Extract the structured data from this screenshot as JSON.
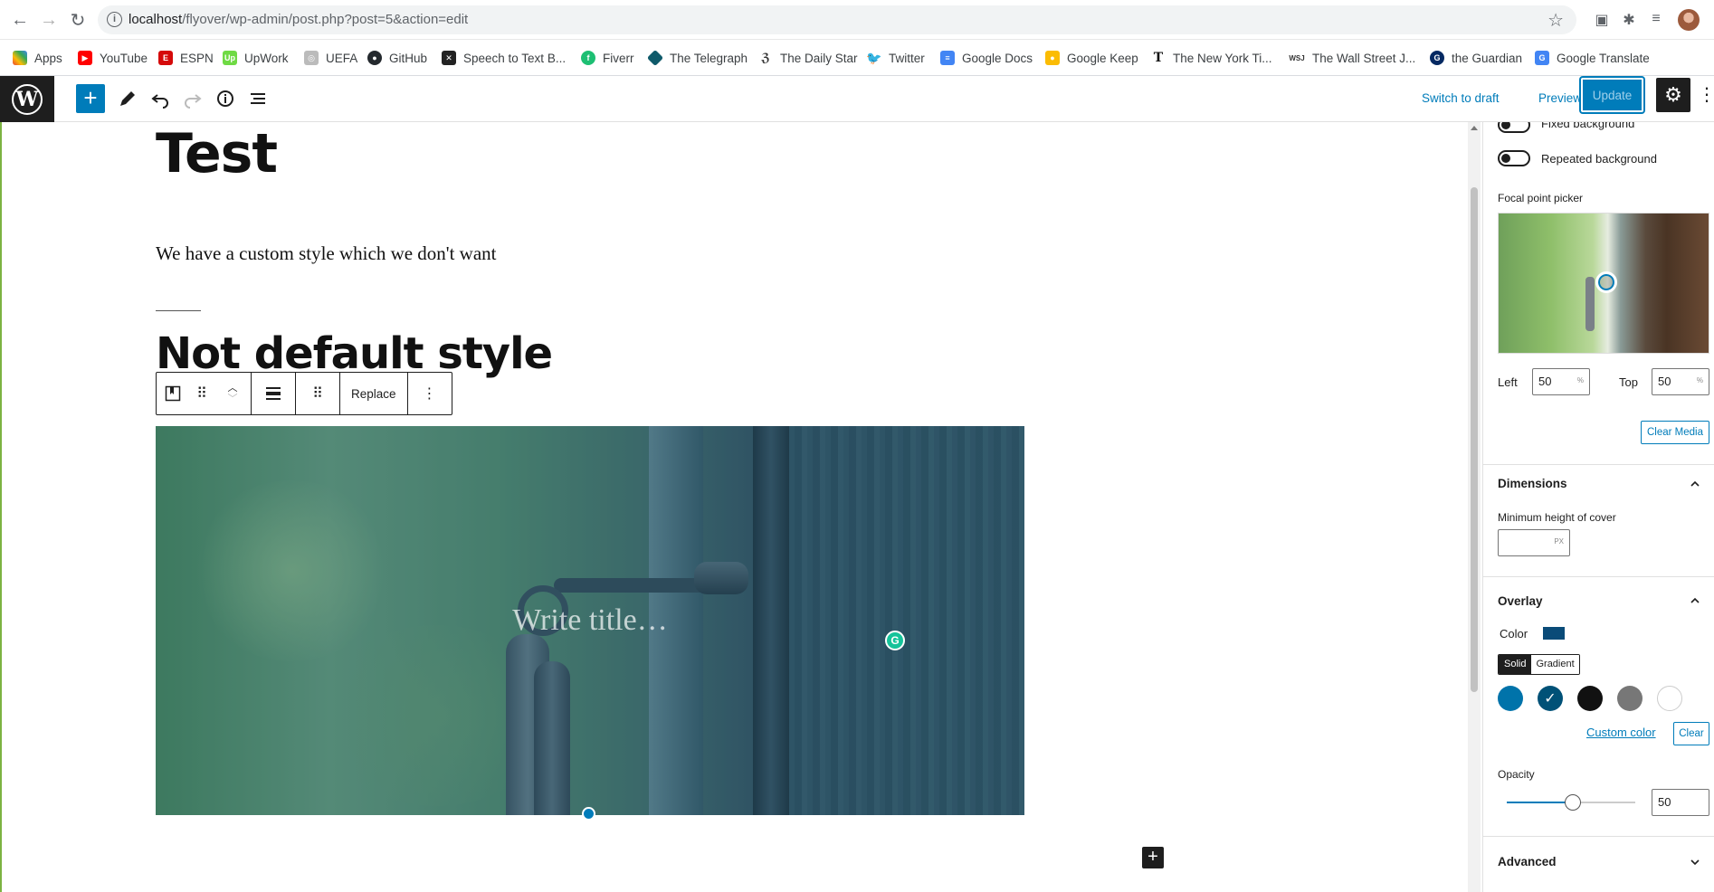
{
  "browser": {
    "url_host": "localhost",
    "url_path": "/flyover/wp-admin/post.php?post=5&action=edit",
    "bookmarks": [
      {
        "label": "Apps",
        "color": "#4285f4"
      },
      {
        "label": "YouTube",
        "color": "#ff0000"
      },
      {
        "label": "ESPN",
        "color": "#d50a0a"
      },
      {
        "label": "UpWork",
        "color": "#6fda44"
      },
      {
        "label": "UEFA",
        "color": "#999999"
      },
      {
        "label": "GitHub",
        "color": "#24292e"
      },
      {
        "label": "Speech to Text B...",
        "color": "#222222"
      },
      {
        "label": "Fiverr",
        "color": "#1dbf73"
      },
      {
        "label": "The Telegraph",
        "color": "#0f5a6a"
      },
      {
        "label": "The Daily Star",
        "color": "#444444"
      },
      {
        "label": "Twitter",
        "color": "#1da1f2"
      },
      {
        "label": "Google Docs",
        "color": "#4285f4"
      },
      {
        "label": "Google Keep",
        "color": "#fbbc04"
      },
      {
        "label": "The New York Ti...",
        "color": "#111111"
      },
      {
        "label": "The Wall Street J...",
        "color": "#333333"
      },
      {
        "label": "the Guardian",
        "color": "#052962"
      },
      {
        "label": "Google Translate",
        "color": "#4285f4"
      }
    ]
  },
  "header": {
    "switch_to_draft": "Switch to draft",
    "preview": "Preview",
    "update": "Update"
  },
  "content": {
    "title": "Test",
    "paragraph": "We have a custom style which we don't want",
    "heading": "Not default style",
    "toolbar_replace": "Replace",
    "cover_placeholder": "Write title…"
  },
  "sidebar": {
    "fixed_background": "Fixed background",
    "repeated_background": "Repeated background",
    "focal_point_picker": "Focal point picker",
    "left_label": "Left",
    "left_value": "50",
    "top_label": "Top",
    "top_value": "50",
    "percent": "%",
    "clear_media": "Clear Media",
    "dimensions": "Dimensions",
    "min_height_label": "Minimum height of cover",
    "px_unit": "PX",
    "overlay": "Overlay",
    "color_label": "Color",
    "overlay_color": "#0a4b78",
    "solid": "Solid",
    "gradient": "Gradient",
    "swatches": [
      "#0073aa",
      "#005177",
      "#111111",
      "#777777",
      "#ffffff"
    ],
    "custom_color": "Custom color",
    "clear": "Clear",
    "opacity_label": "Opacity",
    "opacity_value": "50",
    "advanced": "Advanced"
  }
}
